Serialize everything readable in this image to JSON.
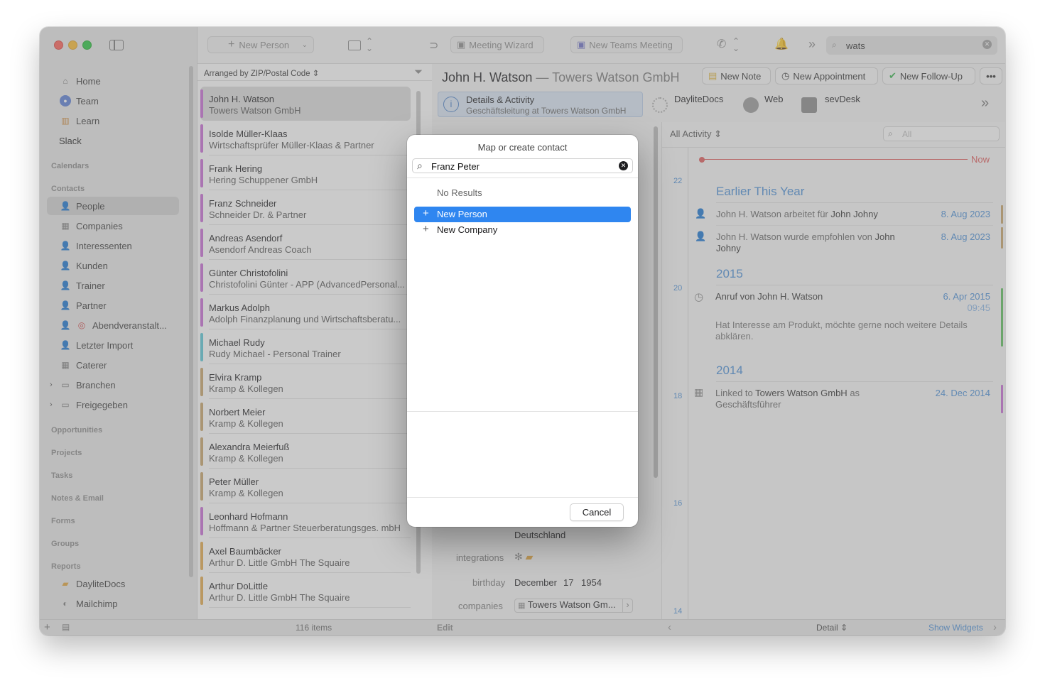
{
  "toolbar": {
    "new_person": "New Person",
    "meeting_wizard": "Meeting Wizard",
    "new_teams_meeting": "New Teams Meeting",
    "search_value": "wats"
  },
  "sidebar": {
    "top_items": [
      {
        "label": "Home",
        "icon": "house-icon"
      },
      {
        "label": "Team",
        "icon": "team-icon"
      },
      {
        "label": "Learn",
        "icon": "books-icon"
      },
      {
        "label": "Slack",
        "icon": ""
      }
    ],
    "sections": {
      "calendars": "Calendars",
      "contacts": "Contacts",
      "opportunities": "Opportunities",
      "projects": "Projects",
      "tasks": "Tasks",
      "notes_email": "Notes & Email",
      "forms": "Forms",
      "groups": "Groups",
      "reports": "Reports"
    },
    "contacts_items": [
      {
        "label": "People",
        "icon": "person-icon"
      },
      {
        "label": "Companies",
        "icon": "building-icon"
      },
      {
        "label": "Interessenten",
        "icon": "person-group-icon"
      },
      {
        "label": "Kunden",
        "icon": "person-group-icon"
      },
      {
        "label": "Trainer",
        "icon": "person-group-icon"
      },
      {
        "label": "Partner",
        "icon": "person-group-icon"
      },
      {
        "label": "Abendveranstalt...",
        "icon": "target-icon"
      },
      {
        "label": "Letzter Import",
        "icon": "person-group-icon"
      },
      {
        "label": "Caterer",
        "icon": "building-group-icon"
      },
      {
        "label": "Branchen",
        "icon": "folder-icon"
      },
      {
        "label": "Freigegeben",
        "icon": "folder-icon"
      }
    ],
    "report_items": [
      {
        "label": "DayliteDocs",
        "icon": "folder-icon"
      },
      {
        "label": "Mailchimp",
        "icon": "mailchimp-icon"
      }
    ]
  },
  "list": {
    "arranged_by": "Arranged by ZIP/Postal Code",
    "count": "116 items",
    "rows": [
      {
        "name": "John H. Watson",
        "company": "Towers Watson GmbH",
        "color": "#c86bd6"
      },
      {
        "name": "Isolde Müller-Klaas",
        "company": "Wirtschaftsprüfer Müller-Klaas & Partner",
        "color": "#c86bd6"
      },
      {
        "name": "Frank Hering",
        "company": "Hering Schuppener GmbH",
        "color": "#c86bd6"
      },
      {
        "name": "Franz Schneider",
        "company": "Schneider Dr. & Partner",
        "color": "#c86bd6"
      },
      {
        "name": "Andreas Asendorf",
        "company": "Asendorf Andreas Coach",
        "color": "#c86bd6"
      },
      {
        "name": "Günter Christofolini",
        "company": "Christofolini Günter - APP (AdvancedPersonal...",
        "color": "#c86bd6"
      },
      {
        "name": "Markus Adolph",
        "company": "Adolph Finanzplanung und Wirtschaftsberatu...",
        "color": "#c86bd6"
      },
      {
        "name": "Michael Rudy",
        "company": "Rudy Michael - Personal Trainer",
        "color": "#5ac8d8"
      },
      {
        "name": "Elvira Kramp",
        "company": "Kramp & Kollegen",
        "color": "#c9a46a"
      },
      {
        "name": "Norbert Meier",
        "company": "Kramp & Kollegen",
        "color": "#c9a46a"
      },
      {
        "name": "Alexandra Meierfuß",
        "company": "Kramp & Kollegen",
        "color": "#c9a46a"
      },
      {
        "name": "Peter Müller",
        "company": "Kramp & Kollegen",
        "color": "#c9a46a"
      },
      {
        "name": "Leonhard Hofmann",
        "company": "Hoffmann & Partner Steuerberatungsges. mbH",
        "color": "#c86bd6"
      },
      {
        "name": "Axel Baumbäcker",
        "company": "Arthur D. Little GmbH The Squaire",
        "color": "#e3a94a"
      },
      {
        "name": "Arthur DoLittle",
        "company": "Arthur D. Little GmbH The Squaire",
        "color": "#e3a94a"
      }
    ]
  },
  "detail": {
    "name": "John H. Watson",
    "company": "— Towers Watson GmbH",
    "new_note": "New Note",
    "new_appointment": "New Appointment",
    "new_followup": "New Follow-Up",
    "tabs": {
      "details_title": "Details & Activity",
      "details_sub": "Geschäftsleitung at Towers Watson GmbH",
      "daylitedocs": "DayliteDocs",
      "web": "Web",
      "sevdesk": "sevDesk"
    },
    "fields": {
      "country": "Deutschland",
      "integrations_label": "integrations",
      "birthday_label": "birthday",
      "birthday_month": "December",
      "birthday_day": "17",
      "birthday_year": "1954",
      "companies_label": "companies",
      "companies_value": "Towers Watson Gm..."
    },
    "edit": "Edit"
  },
  "activity": {
    "filter": "All Activity",
    "search_placeholder": "All",
    "now": "Now",
    "axis": [
      "22",
      "20",
      "18",
      "16",
      "14"
    ],
    "headers": {
      "earlier": "Earlier This Year",
      "y2015": "2015",
      "y2014": "2014"
    },
    "items": [
      {
        "text_pre": "John H. Watson arbeitet für ",
        "text_strong": "John Johny",
        "date": "8. Aug 2023"
      },
      {
        "text_pre": "John H. Watson wurde empfohlen von ",
        "text_strong": "John Johny",
        "date": "8. Aug 2023"
      },
      {
        "text": "Anruf von John H. Watson",
        "date": "6. Apr 2015",
        "time": "09:45",
        "note": "Hat Interesse am Produkt, möchte gerne noch weitere Details abklären."
      },
      {
        "text_pre": "Linked to ",
        "text_strong": "Towers Watson GmbH",
        "text_post": " as Geschäftsführer",
        "date": "24. Dec 2014"
      }
    ],
    "footer_mode": "Detail",
    "show_widgets": "Show Widgets"
  },
  "modal": {
    "title": "Map or create contact",
    "search_value": "Franz Peter",
    "no_results": "No Results",
    "new_person": "New Person",
    "new_company": "New Company",
    "cancel": "Cancel"
  },
  "colors": {
    "accent": "#2f86f0",
    "selection": "#2f86f0",
    "now_line": "#e05b5b",
    "link_blue": "#4a8fd8"
  }
}
